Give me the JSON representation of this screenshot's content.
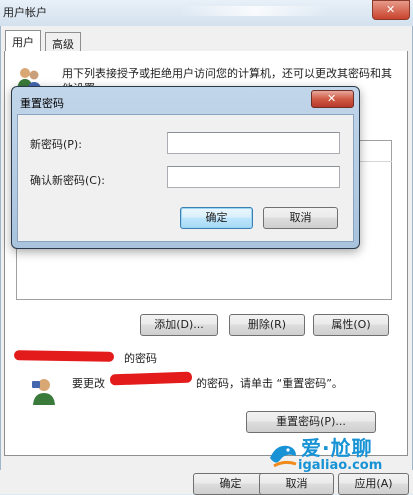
{
  "window": {
    "title": "用户帐户"
  },
  "tabs": [
    {
      "label": "用户"
    },
    {
      "label": "高级"
    }
  ],
  "description": "用下列表接授予或拒绝用户访问您的计算机，还可以更改其密码和其他设置。",
  "list_buttons": {
    "add": "添加(D)...",
    "remove": "删除(R)",
    "properties": "属性(O)"
  },
  "password_section": {
    "title_suffix": "的密码",
    "text_before": "要更改",
    "text_after": "的密码，请单击 “重置密码”。",
    "reset_button": "重置密码(P)..."
  },
  "bottom_buttons": {
    "ok": "确定",
    "cancel": "取消",
    "apply": "应用(A)"
  },
  "dialog": {
    "title": "重置密码",
    "new_password_label": "新密码(P):",
    "new_password_value": "",
    "confirm_label": "确认新密码(C):",
    "confirm_value": "",
    "ok": "确定",
    "cancel": "取消"
  },
  "watermark": {
    "title": "爱·尬聊",
    "url": "igaliao.com"
  },
  "colors": {
    "accent": "#1793d5",
    "redaction": "#e31b1b",
    "focus": "#3c7fb1"
  }
}
